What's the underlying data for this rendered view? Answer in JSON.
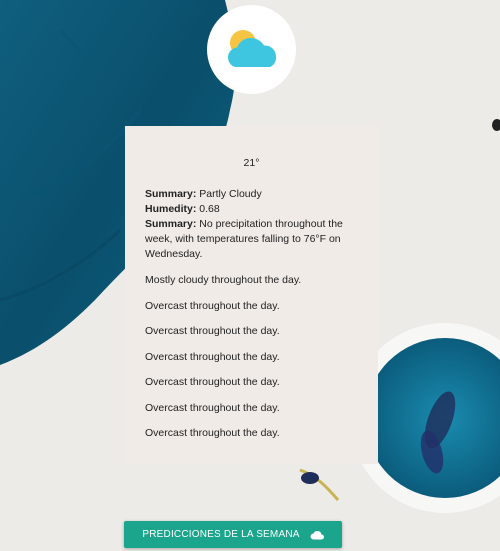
{
  "weather": {
    "temperature": "21°",
    "summary_label": "Summary:",
    "summary_value": "Partly Cloudy",
    "humidity_label": "Humedity:",
    "humidity_value": "0.68",
    "week_summary_label": "Summary:",
    "week_summary_value": "No precipitation throughout the week, with temperatures falling to 76°F on Wednesday.",
    "daily": [
      "Mostly cloudy throughout the day.",
      "Overcast throughout the day.",
      "Overcast throughout the day.",
      "Overcast throughout the day.",
      "Overcast throughout the day.",
      "Overcast throughout the day.",
      "Overcast throughout the day."
    ]
  },
  "button": {
    "label": "Predicciones de la semana",
    "icon": "cloud-icon"
  },
  "logo": {
    "icon": "partly-cloudy-icon"
  },
  "colors": {
    "accent": "#1aa58c",
    "card": "#f1ebe7",
    "cloud": "#3ec6e0",
    "sun": "#f6c443"
  }
}
